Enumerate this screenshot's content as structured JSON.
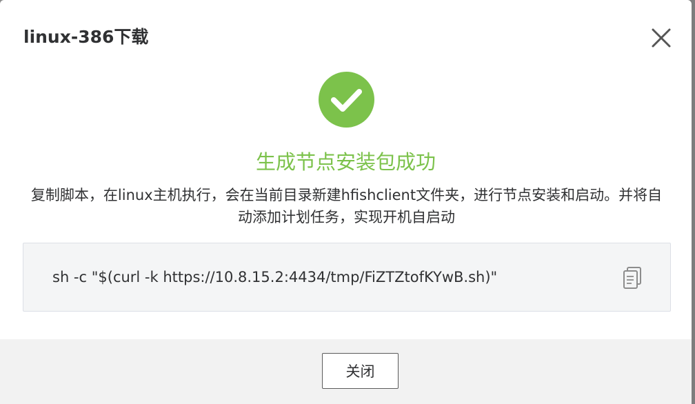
{
  "dialog": {
    "title": "linux-386下载",
    "success_title": "生成节点安装包成功",
    "description": "复制脚本，在linux主机执行，会在当前目录新建hfishclient文件夹，进行节点安装和启动。并将自动添加计划任务，实现开机自启动",
    "command": "sh -c \"$(curl -k https://10.8.15.2:4434/tmp/FiZTZtofKYwB.sh)\"",
    "close_button_label": "关闭"
  },
  "icons": {
    "close": "close-icon",
    "success": "check-circle-icon",
    "copy": "copy-icon"
  },
  "colors": {
    "success": "#7cc24b",
    "title_text": "#303133",
    "code_background": "#f4f5f6",
    "footer_background": "#f2f2f2"
  }
}
